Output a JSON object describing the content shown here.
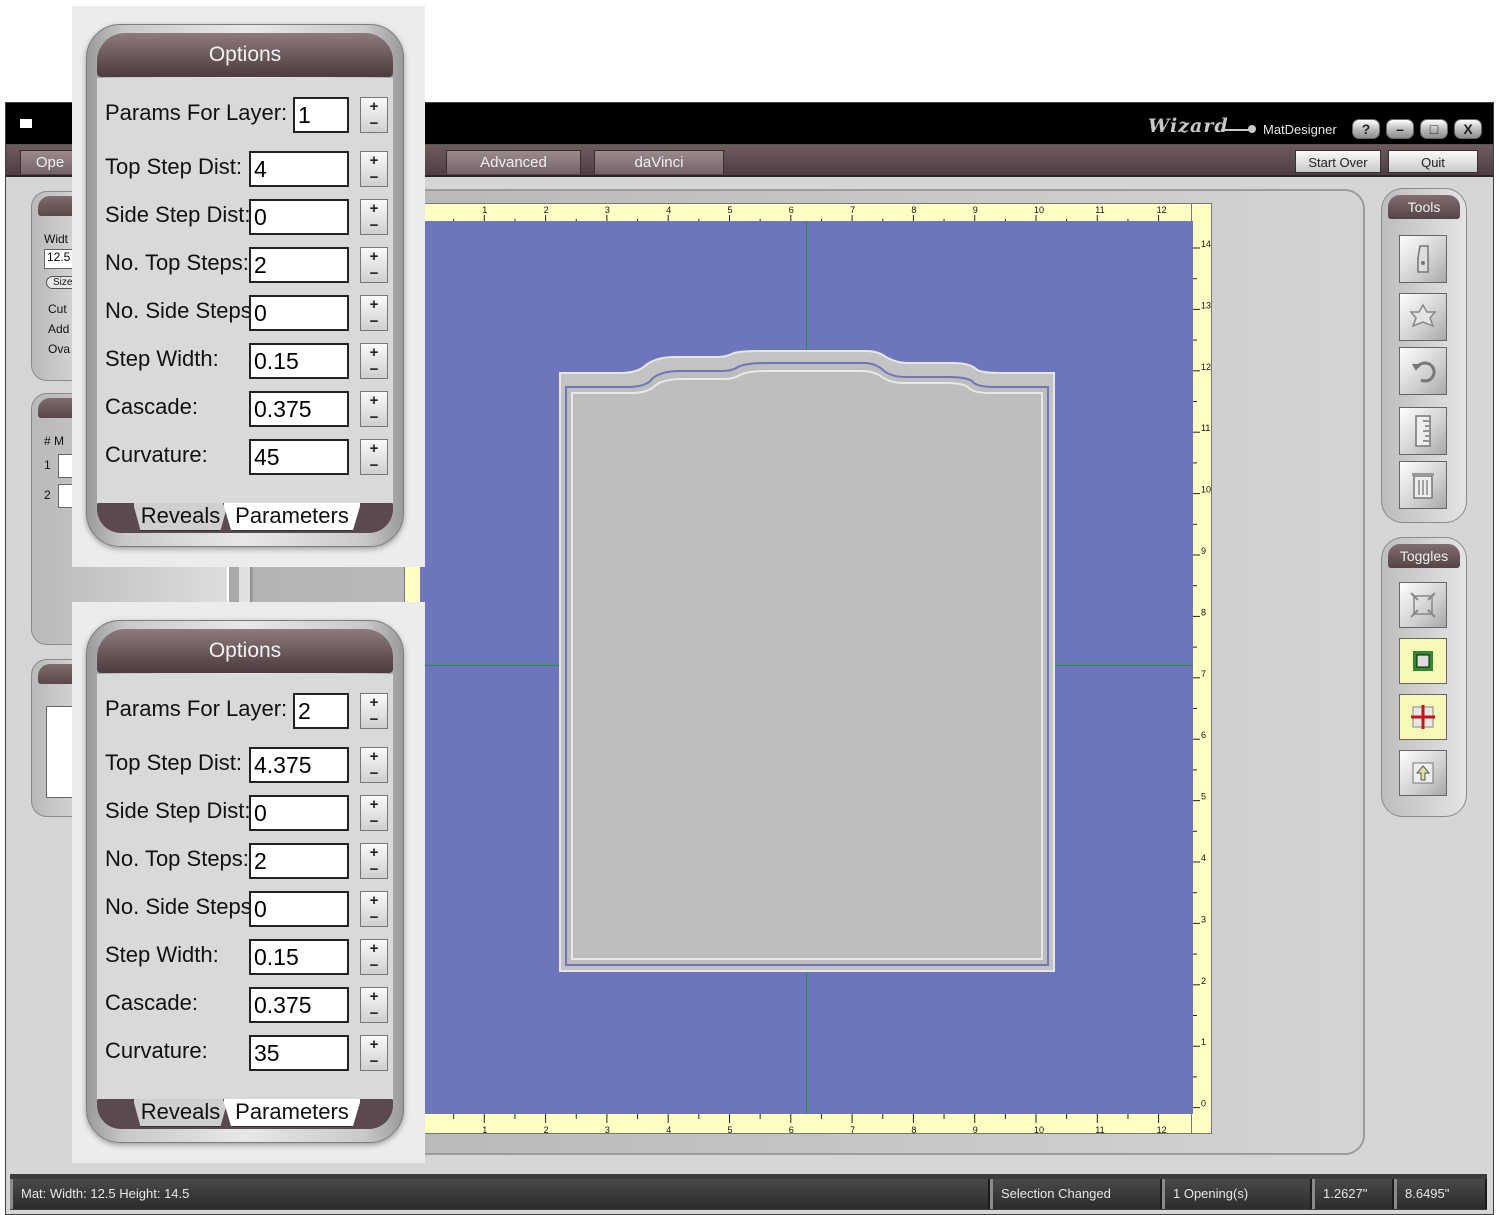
{
  "window": {
    "app_name": "MatDesigner",
    "logo_text": "Wizard",
    "help_btn": "?",
    "min_btn": "–",
    "max_btn": "□",
    "close_btn": "X"
  },
  "tabs": [
    {
      "label": "Ope"
    },
    {
      "label": "Advanced"
    },
    {
      "label": "daVinci"
    }
  ],
  "right_buttons": {
    "start_over": "Start Over",
    "quit": "Quit"
  },
  "left_panel": {
    "width_label": "Widt",
    "width_value": "12.5",
    "size_btn": "Size",
    "cut_label": "Cut",
    "add_label": "Add",
    "oval_label": "Ova",
    "list_header": "# M",
    "row1": "1",
    "row2": "2"
  },
  "ruler": {
    "top_ticks": [
      "1",
      "2",
      "3",
      "4",
      "5",
      "6",
      "7",
      "8",
      "9",
      "10",
      "11",
      "12"
    ],
    "right_ticks": [
      "14",
      "13",
      "12",
      "11",
      "10",
      "9",
      "8",
      "7",
      "6",
      "5",
      "4",
      "3",
      "2",
      "1",
      "0"
    ]
  },
  "tools": {
    "title": "Tools",
    "items": [
      "blade-icon",
      "recycle-icon",
      "undo-icon",
      "ruler-icon",
      "trash-icon"
    ]
  },
  "toggles": {
    "title": "Toggles",
    "items": [
      "fit-view-icon",
      "select-opening-icon",
      "center-cross-icon",
      "bring-up-icon"
    ]
  },
  "status": {
    "mat_size": "Mat: Width: 12.5   Height: 14.5",
    "message": "Selection Changed",
    "openings": "1 Opening(s)",
    "x_coord": "1.2627\"",
    "y_coord": "8.6495\""
  },
  "options": [
    {
      "title": "Options",
      "params_for_layer_label": "Params For Layer:",
      "params_for_layer": "1",
      "top_step_dist_label": "Top Step Dist:",
      "top_step_dist": "4",
      "side_step_dist_label": "Side Step Dist:",
      "side_step_dist": "0",
      "no_top_steps_label": "No. Top Steps:",
      "no_top_steps": "2",
      "no_side_steps_label": "No. Side Steps",
      "no_side_steps": "0",
      "step_width_label": "Step Width:",
      "step_width": "0.15",
      "cascade_label": "Cascade:",
      "cascade": "0.375",
      "curvature_label": "Curvature:",
      "curvature": "45",
      "tab_reveals": "Reveals",
      "tab_parameters": "Parameters"
    },
    {
      "title": "Options",
      "params_for_layer_label": "Params For Layer:",
      "params_for_layer": "2",
      "top_step_dist_label": "Top Step Dist:",
      "top_step_dist": "4.375",
      "side_step_dist_label": "Side Step Dist:",
      "side_step_dist": "0",
      "no_top_steps_label": "No. Top Steps:",
      "no_top_steps": "2",
      "no_side_steps_label": "No. Side Steps",
      "no_side_steps": "0",
      "step_width_label": "Step Width:",
      "step_width": "0.15",
      "cascade_label": "Cascade:",
      "cascade": "0.375",
      "curvature_label": "Curvature:",
      "curvature": "35",
      "tab_reveals": "Reveals",
      "tab_parameters": "Parameters"
    }
  ],
  "colors": {
    "mat": "#6d76bd",
    "opening": "#bcbcbc",
    "guide": "#1a9a2a",
    "ruler": "#ffffc4",
    "panel_header": "#5f4d50"
  }
}
